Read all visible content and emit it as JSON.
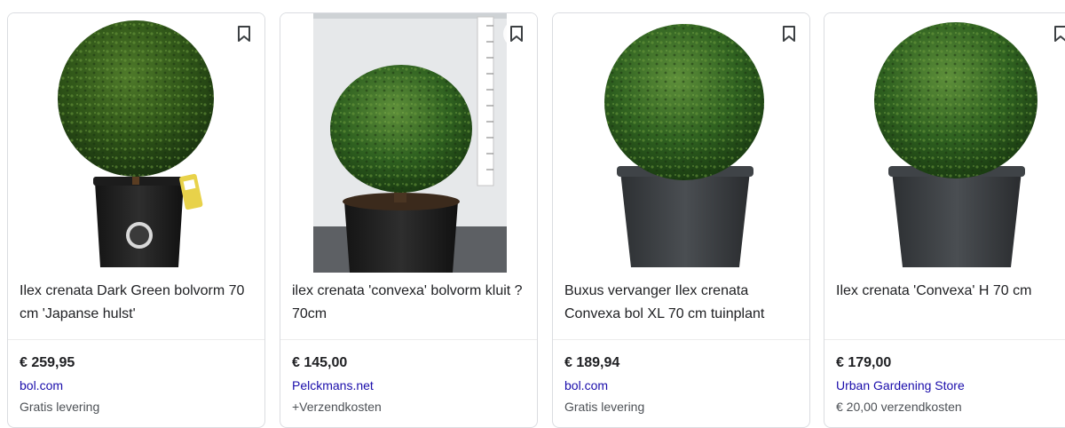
{
  "products": [
    {
      "image": "ilex-bol-on-black-pot",
      "title": "Ilex crenata Dark Green bolvorm 70 cm 'Japanse hulst'",
      "price": "€ 259,95",
      "merchant": "bol.com",
      "shipping": "Gratis levering"
    },
    {
      "image": "ilex-bol-with-height-ruler",
      "title": "ilex crenata 'convexa' bolvorm kluit ?70cm",
      "price": "€ 145,00",
      "merchant": "Pelckmans.net",
      "shipping": "+Verzendkosten"
    },
    {
      "image": "buxus-ball-grey-pot",
      "title": "Buxus vervanger Ilex crenata Convexa bol XL 70 cm tuinplant",
      "price": "€ 189,94",
      "merchant": "bol.com",
      "shipping": "Gratis levering"
    },
    {
      "image": "ilex-ball-grey-pot",
      "title": "Ilex crenata 'Convexa' H 70 cm",
      "price": "€ 179,00",
      "merchant": "Urban Gardening Store",
      "shipping": "€ 20,00 verzendkosten"
    }
  ],
  "icons": {
    "save": "bookmark-icon"
  },
  "colors": {
    "merchant_link": "#1a0dab",
    "muted_text": "#4d5156",
    "card_border": "#dadce0"
  }
}
